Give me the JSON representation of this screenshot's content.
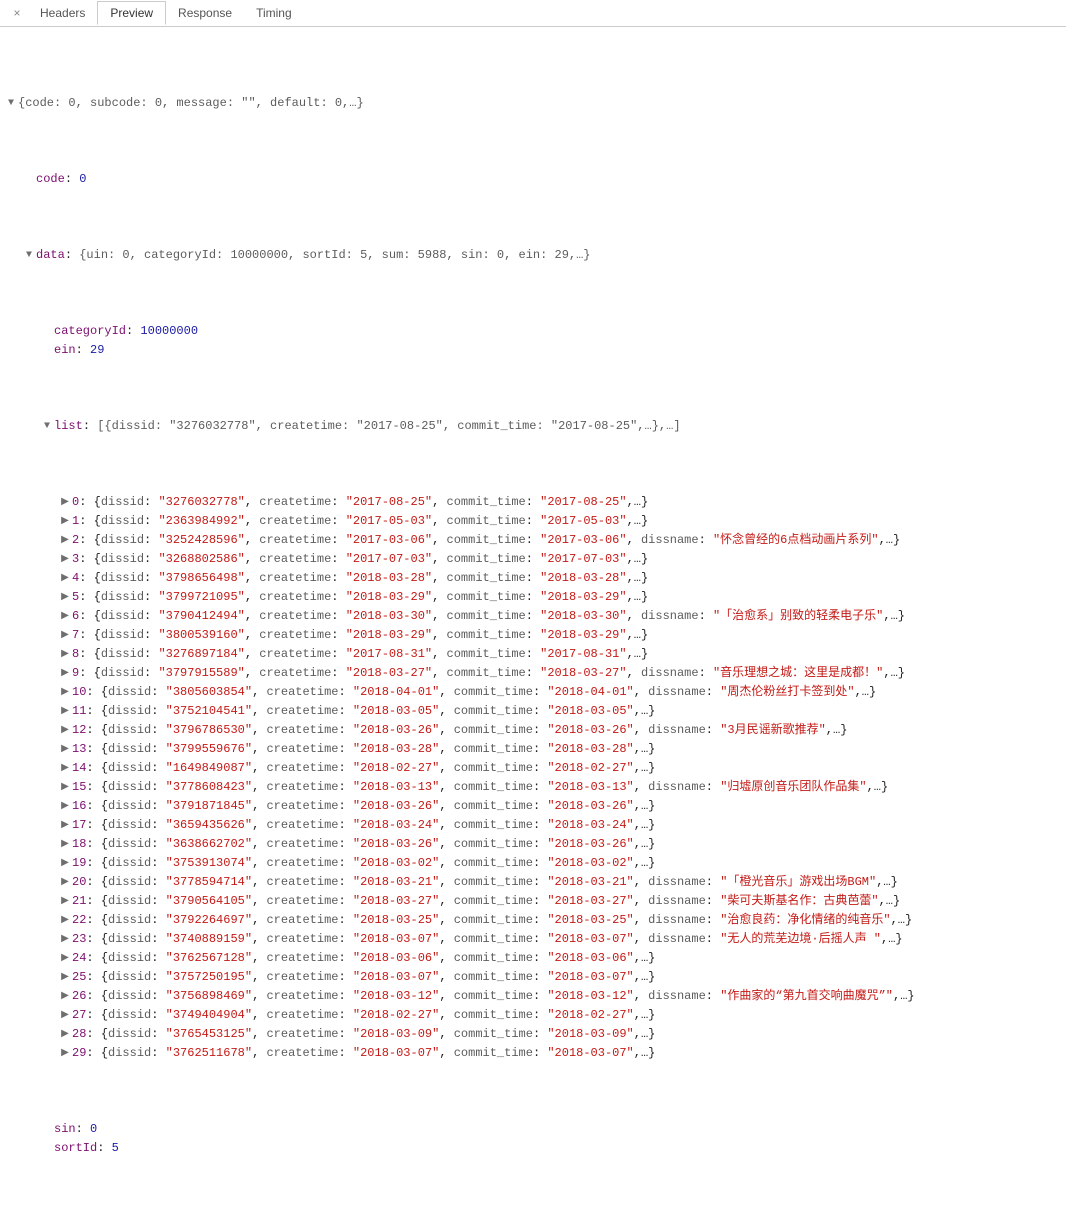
{
  "tabs": {
    "items": [
      "Headers",
      "Preview",
      "Response",
      "Timing"
    ],
    "activeIndex": 1
  },
  "root_summary": "{code: 0, subcode: 0, message: \"\", default: 0,…}",
  "code_line": {
    "key": "code",
    "value": "0"
  },
  "data_summary": "{uin: 0, categoryId: 10000000, sortId: 5, sum: 5988, sin: 0, ein: 29,…}",
  "data_inline": [
    {
      "key": "categoryId",
      "value": "10000000",
      "type": "num"
    },
    {
      "key": "ein",
      "value": "29",
      "type": "num"
    }
  ],
  "list_header": "[{dissid: \"3276032778\", createtime: \"2017-08-25\", commit_time: \"2017-08-25\",…},…]",
  "list": [
    {
      "idx": "0",
      "dissid": "3276032778",
      "createtime": "2017-08-25",
      "commit_time": "2017-08-25"
    },
    {
      "idx": "1",
      "dissid": "2363984992",
      "createtime": "2017-05-03",
      "commit_time": "2017-05-03"
    },
    {
      "idx": "2",
      "dissid": "3252428596",
      "createtime": "2017-03-06",
      "commit_time": "2017-03-06",
      "dissname": "怀念曾经的6点档动画片系列"
    },
    {
      "idx": "3",
      "dissid": "3268802586",
      "createtime": "2017-07-03",
      "commit_time": "2017-07-03"
    },
    {
      "idx": "4",
      "dissid": "3798656498",
      "createtime": "2018-03-28",
      "commit_time": "2018-03-28"
    },
    {
      "idx": "5",
      "dissid": "3799721095",
      "createtime": "2018-03-29",
      "commit_time": "2018-03-29"
    },
    {
      "idx": "6",
      "dissid": "3790412494",
      "createtime": "2018-03-30",
      "commit_time": "2018-03-30",
      "dissname": "「治愈系」别致的轻柔电子乐"
    },
    {
      "idx": "7",
      "dissid": "3800539160",
      "createtime": "2018-03-29",
      "commit_time": "2018-03-29"
    },
    {
      "idx": "8",
      "dissid": "3276897184",
      "createtime": "2017-08-31",
      "commit_time": "2017-08-31"
    },
    {
      "idx": "9",
      "dissid": "3797915589",
      "createtime": "2018-03-27",
      "commit_time": "2018-03-27",
      "dissname": "音乐理想之城：这里是成都！"
    },
    {
      "idx": "10",
      "dissid": "3805603854",
      "createtime": "2018-04-01",
      "commit_time": "2018-04-01",
      "dissname": "周杰伦粉丝打卡签到处"
    },
    {
      "idx": "11",
      "dissid": "3752104541",
      "createtime": "2018-03-05",
      "commit_time": "2018-03-05"
    },
    {
      "idx": "12",
      "dissid": "3796786530",
      "createtime": "2018-03-26",
      "commit_time": "2018-03-26",
      "dissname": "3月民谣新歌推荐"
    },
    {
      "idx": "13",
      "dissid": "3799559676",
      "createtime": "2018-03-28",
      "commit_time": "2018-03-28"
    },
    {
      "idx": "14",
      "dissid": "1649849087",
      "createtime": "2018-02-27",
      "commit_time": "2018-02-27"
    },
    {
      "idx": "15",
      "dissid": "3778608423",
      "createtime": "2018-03-13",
      "commit_time": "2018-03-13",
      "dissname": "归墟原创音乐团队作品集"
    },
    {
      "idx": "16",
      "dissid": "3791871845",
      "createtime": "2018-03-26",
      "commit_time": "2018-03-26"
    },
    {
      "idx": "17",
      "dissid": "3659435626",
      "createtime": "2018-03-24",
      "commit_time": "2018-03-24"
    },
    {
      "idx": "18",
      "dissid": "3638662702",
      "createtime": "2018-03-26",
      "commit_time": "2018-03-26"
    },
    {
      "idx": "19",
      "dissid": "3753913074",
      "createtime": "2018-03-02",
      "commit_time": "2018-03-02"
    },
    {
      "idx": "20",
      "dissid": "3778594714",
      "createtime": "2018-03-21",
      "commit_time": "2018-03-21",
      "dissname": "「橙光音乐」游戏出场BGM"
    },
    {
      "idx": "21",
      "dissid": "3790564105",
      "createtime": "2018-03-27",
      "commit_time": "2018-03-27",
      "dissname": "柴可夫斯基名作：古典芭蕾"
    },
    {
      "idx": "22",
      "dissid": "3792264697",
      "createtime": "2018-03-25",
      "commit_time": "2018-03-25",
      "dissname": "治愈良药：净化情绪的纯音乐"
    },
    {
      "idx": "23",
      "dissid": "3740889159",
      "createtime": "2018-03-07",
      "commit_time": "2018-03-07",
      "dissname": "无人的荒芜边境·后摇人声 "
    },
    {
      "idx": "24",
      "dissid": "3762567128",
      "createtime": "2018-03-06",
      "commit_time": "2018-03-06"
    },
    {
      "idx": "25",
      "dissid": "3757250195",
      "createtime": "2018-03-07",
      "commit_time": "2018-03-07"
    },
    {
      "idx": "26",
      "dissid": "3756898469",
      "createtime": "2018-03-12",
      "commit_time": "2018-03-12",
      "dissname": "作曲家的“第九首交响曲魔咒”"
    },
    {
      "idx": "27",
      "dissid": "3749404904",
      "createtime": "2018-02-27",
      "commit_time": "2018-02-27"
    },
    {
      "idx": "28",
      "dissid": "3765453125",
      "createtime": "2018-03-09",
      "commit_time": "2018-03-09"
    },
    {
      "idx": "29",
      "dissid": "3762511678",
      "createtime": "2018-03-07",
      "commit_time": "2018-03-07"
    }
  ],
  "data_trailing": [
    {
      "key": "sin",
      "value": "0",
      "type": "num"
    },
    {
      "key": "sortId",
      "value": "5",
      "type": "num"
    }
  ]
}
